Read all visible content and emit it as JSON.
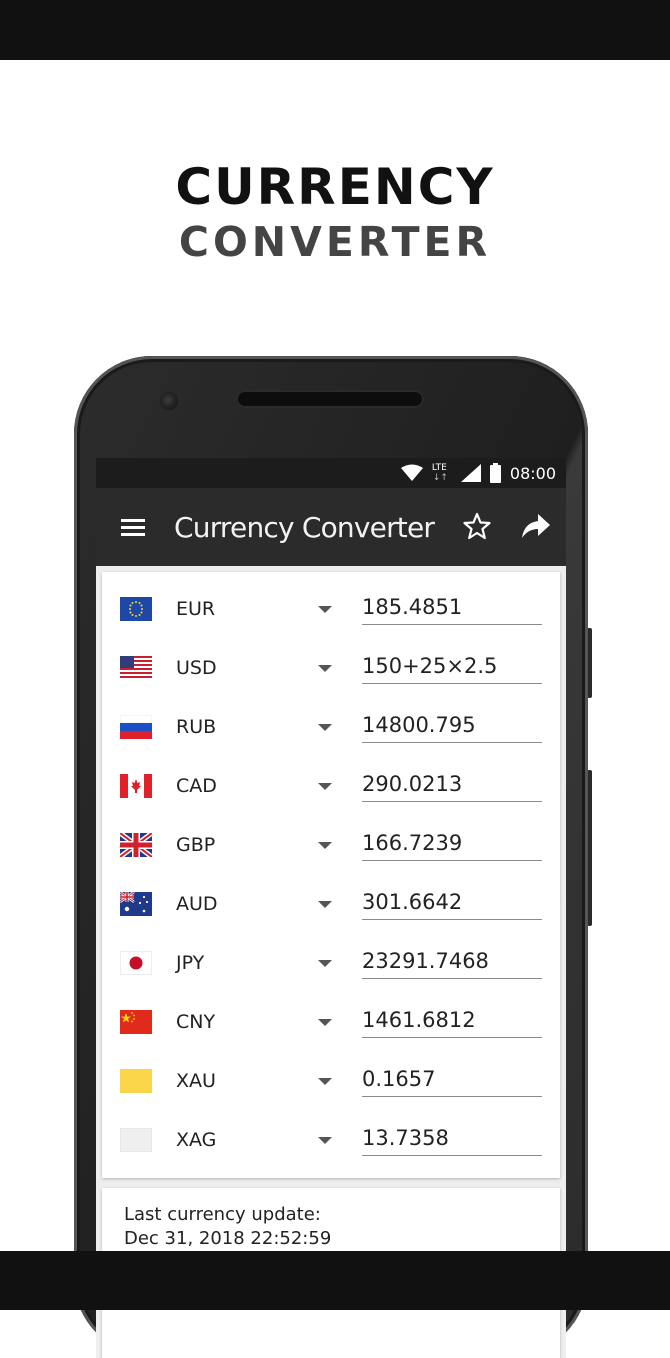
{
  "headline": {
    "line1": "CURRENCY",
    "line2": "CONVERTER"
  },
  "statusbar": {
    "network": "LTE",
    "time": "08:00"
  },
  "toolbar": {
    "title": "Currency Converter",
    "icons": [
      "menu-icon",
      "star-icon",
      "share-icon"
    ]
  },
  "currencies": [
    {
      "code": "EUR",
      "value": "185.4851",
      "flag": "eu-flag-icon"
    },
    {
      "code": "USD",
      "value": "150+25×2.5",
      "flag": "us-flag-icon"
    },
    {
      "code": "RUB",
      "value": "14800.795",
      "flag": "ru-flag-icon"
    },
    {
      "code": "CAD",
      "value": "290.0213",
      "flag": "ca-flag-icon"
    },
    {
      "code": "GBP",
      "value": "166.7239",
      "flag": "gb-flag-icon"
    },
    {
      "code": "AUD",
      "value": "301.6642",
      "flag": "au-flag-icon"
    },
    {
      "code": "JPY",
      "value": "23291.7468",
      "flag": "jp-flag-icon"
    },
    {
      "code": "CNY",
      "value": "1461.6812",
      "flag": "cn-flag-icon"
    },
    {
      "code": "XAU",
      "value": "0.1657",
      "flag": "gold-swatch-icon"
    },
    {
      "code": "XAG",
      "value": "13.7358",
      "flag": "silver-swatch-icon"
    }
  ],
  "update": {
    "label": "Last currency update:",
    "time": "Dec 31, 2018 22:52:59"
  },
  "colors": {
    "toolbar": "#2b2b2b",
    "statusbar": "#1c1c1c",
    "band": "#111111",
    "gold": "#fcd64a",
    "silver": "#efefef"
  }
}
